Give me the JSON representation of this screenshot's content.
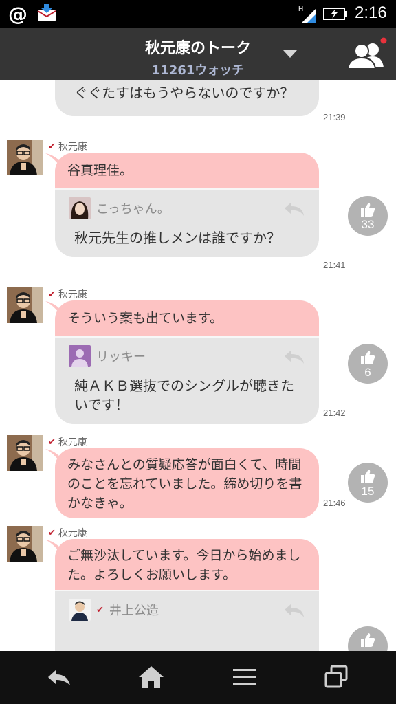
{
  "status_bar": {
    "time": "2:16"
  },
  "header": {
    "title": "秋元康のトーク",
    "subtitle": "11261ウォッチ"
  },
  "top_message": {
    "text": "ぐぐたすはもうやらないのですか？",
    "time": "21:39"
  },
  "posts": [
    {
      "sender": "秋元康",
      "message": "谷真理佳。",
      "quote_author": "こっちゃん。",
      "quote_text": "秋元先生の推しメンは誰ですか？",
      "time": "21:41",
      "likes": "33"
    },
    {
      "sender": "秋元康",
      "message": "そういう案も出ています。",
      "quote_author": "リッキー",
      "quote_text": "純ＡＫＢ選抜でのシングルが聴きたいです！",
      "time": "21:42",
      "likes": "6"
    },
    {
      "sender": "秋元康",
      "message": "みなさんとの質疑応答が面白くて、時間のことを忘れていました。締め切りを書かなきゃ。",
      "time": "21:46",
      "likes": "15"
    },
    {
      "sender": "秋元康",
      "message": "ご無沙汰しています。今日から始めました。よろしくお願いします。",
      "quote_author": "井上公造"
    }
  ],
  "colors": {
    "header_bg": "#353535",
    "bubble_pink": "#fdc3c3",
    "bubble_gray": "#e5e5e5",
    "like_gray": "#b3b3b3",
    "notification_red": "#e8323c"
  },
  "icons": {
    "status": [
      "at-icon",
      "mail-download-icon",
      "signal-icon",
      "battery-charging-icon"
    ],
    "header": [
      "chevron-down-icon",
      "members-icon"
    ],
    "nav": [
      "back-icon",
      "home-icon",
      "menu-icon",
      "recent-apps-icon"
    ]
  }
}
